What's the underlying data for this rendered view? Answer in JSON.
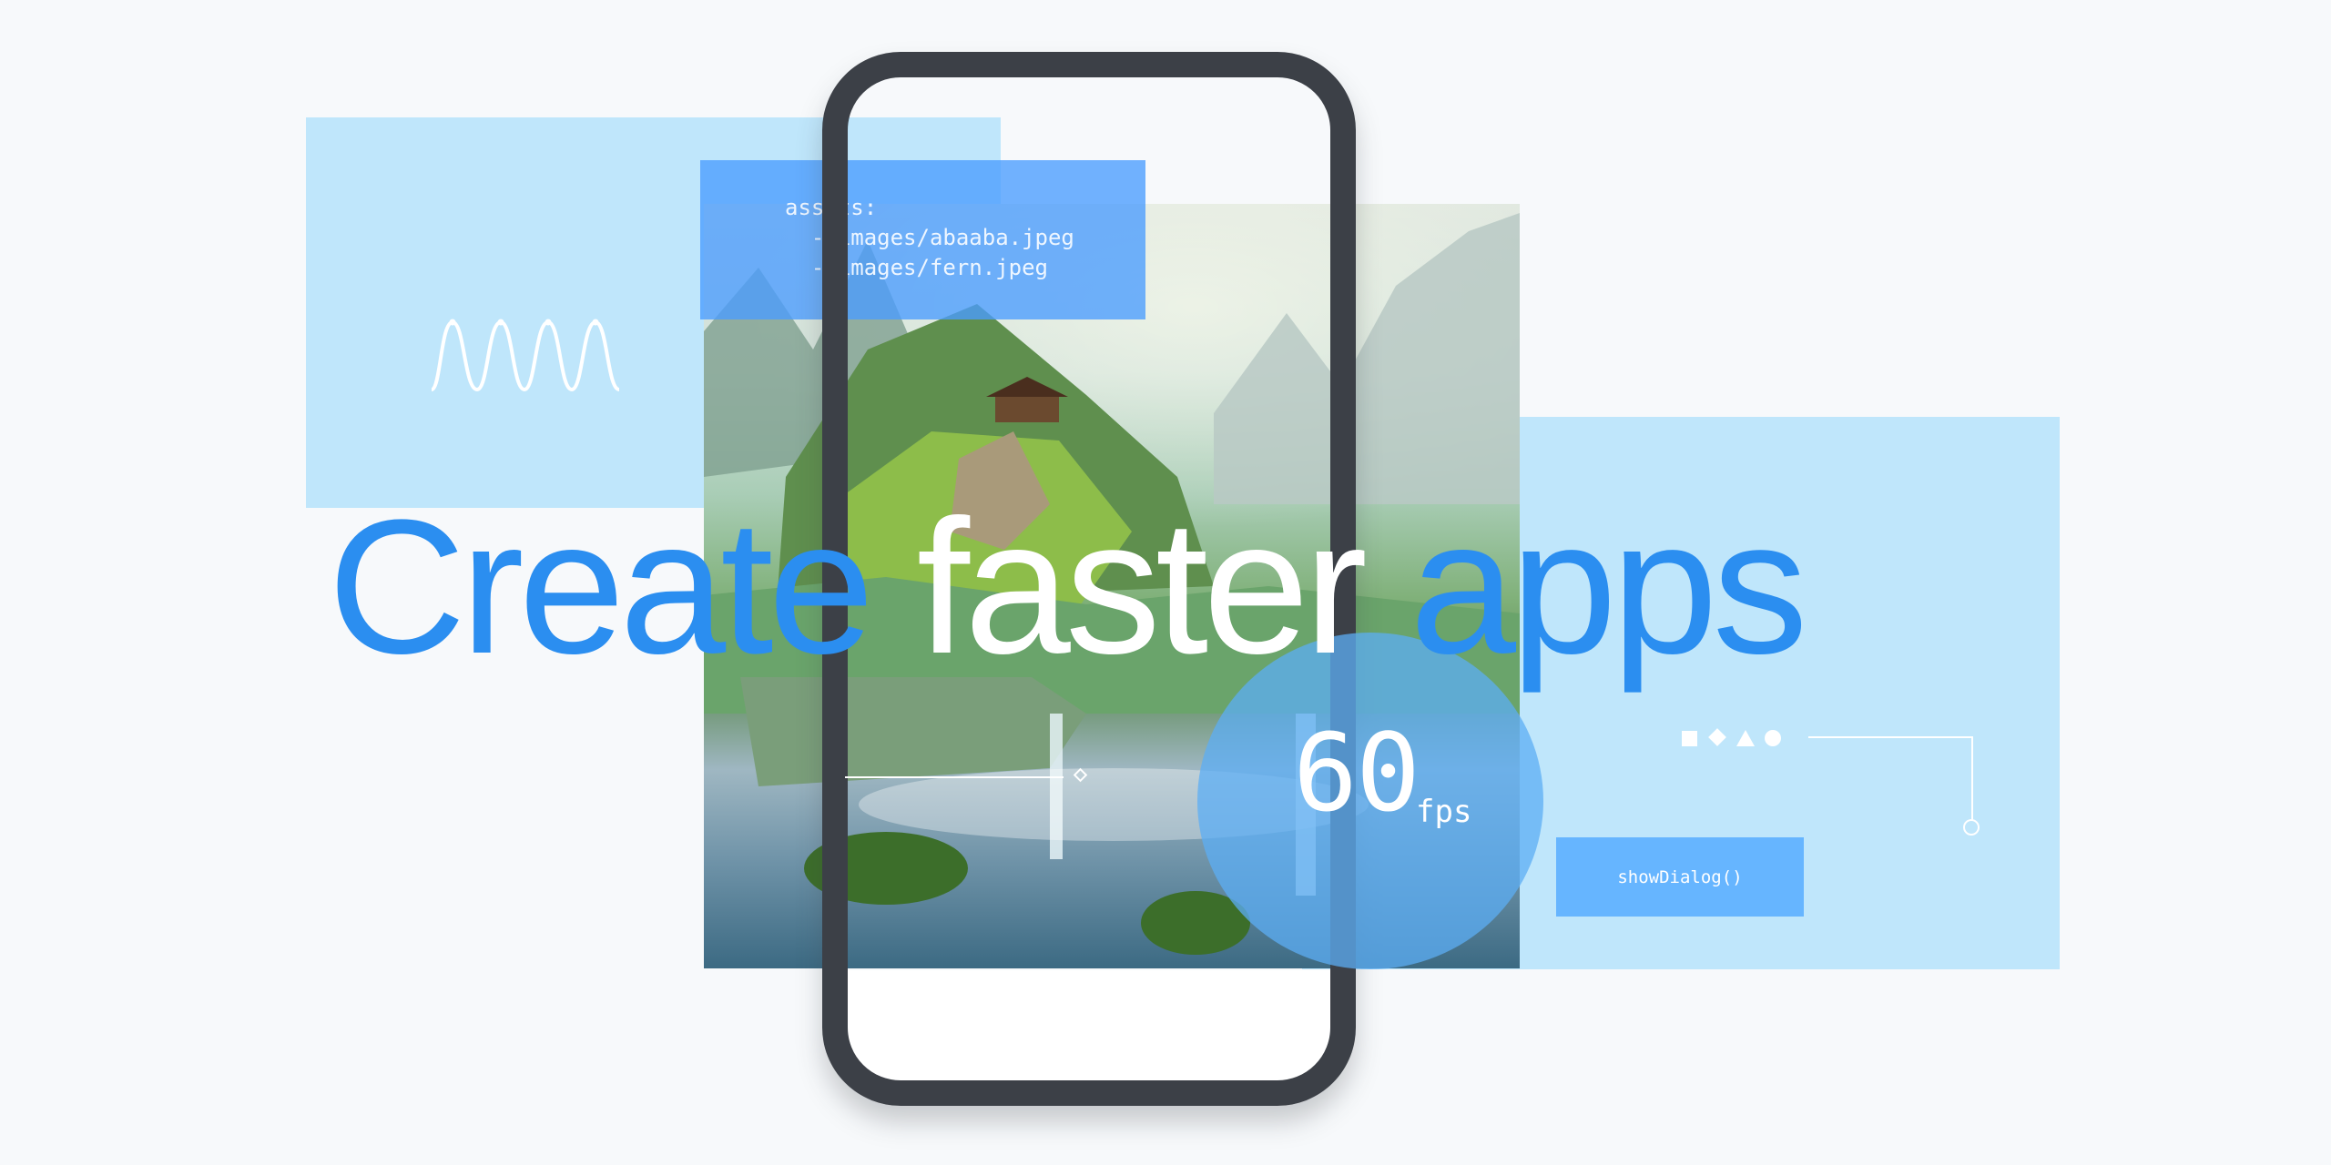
{
  "headline": {
    "word1": "Create",
    "word2": "faster",
    "word3": "apps"
  },
  "code_card": {
    "text": "assets:\n  - images/abaaba.jpeg\n  - images/fern.jpeg"
  },
  "fps": {
    "value": "60",
    "unit": "fps"
  },
  "dialog_button": {
    "label": "showDialog()"
  },
  "icons": {
    "wave": "sine-wave-icon",
    "shapes": [
      "square-icon",
      "diamond-icon",
      "triangle-icon",
      "circle-icon"
    ]
  },
  "colors": {
    "background": "#f7f9fb",
    "panel": "#bfe6fb",
    "accent_blue": "#2b8ef0",
    "phone_frame": "#3c4047"
  }
}
